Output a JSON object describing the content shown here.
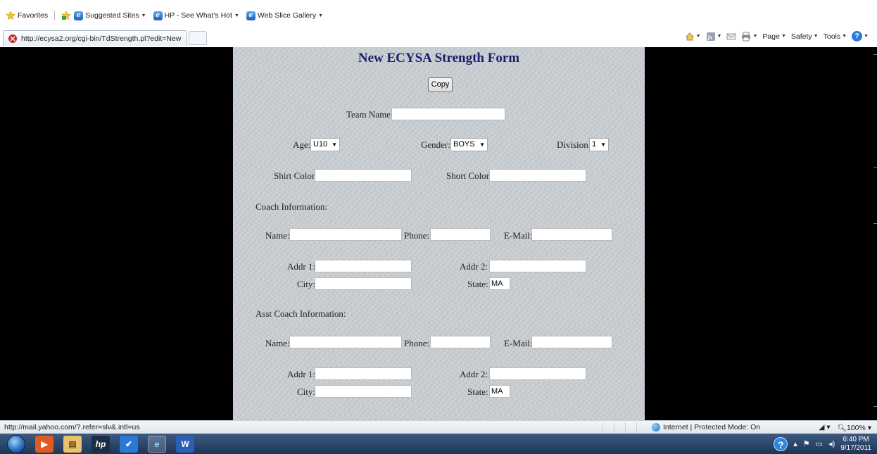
{
  "favorites_bar": {
    "favorites_label": "Favorites",
    "suggested_sites": "Suggested Sites",
    "hp_link": "HP - See What's Hot",
    "web_slice": "Web Slice Gallery"
  },
  "tab": {
    "url": "http://ecysa2.org/cgi-bin/TdStrength.pl?edit=New"
  },
  "command_bar": {
    "page": "Page",
    "safety": "Safety",
    "tools": "Tools"
  },
  "form": {
    "title": "New ECYSA Strength Form",
    "copy_button": "Copy",
    "team_name_label": "Team Name:",
    "age_label": "Age:",
    "age_value": "U10",
    "gender_label": "Gender:",
    "gender_value": "BOYS",
    "division_label": "Division:",
    "division_value": "1",
    "shirt_color_label": "Shirt Color:",
    "short_color_label": "Short Color:",
    "coach": {
      "heading": "Coach Information:",
      "name_label": "Name:",
      "phone_label": "Phone:",
      "email_label": "E-Mail:",
      "addr1_label": "Addr 1:",
      "addr2_label": "Addr 2:",
      "city_label": "City:",
      "state_label": "State:",
      "state_value": "MA"
    },
    "asst_coach": {
      "heading": "Asst Coach Information:",
      "name_label": "Name:",
      "phone_label": "Phone:",
      "email_label": "E-Mail:",
      "addr1_label": "Addr 1:",
      "addr2_label": "Addr 2:",
      "city_label": "City:",
      "state_label": "State:",
      "state_value": "MA"
    }
  },
  "status_bar": {
    "url": "http://mail.yahoo.com/?.refer=slv&.intl=us",
    "zone": "Internet | Protected Mode: On",
    "zoom": "100%"
  },
  "taskbar": {
    "time": "6:40 PM",
    "date": "9/17/2011"
  }
}
